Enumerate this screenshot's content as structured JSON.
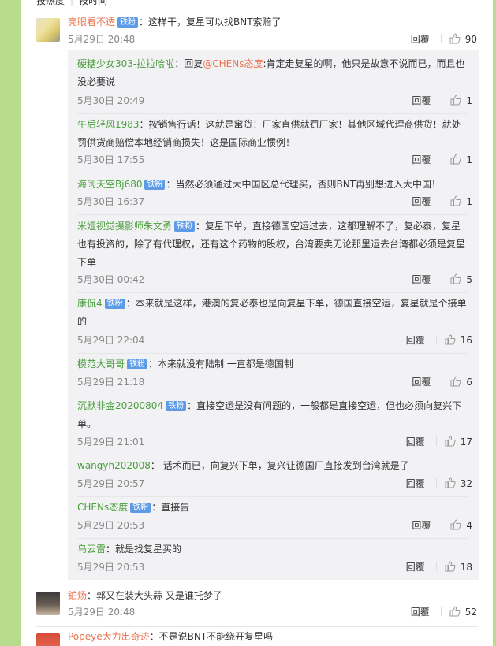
{
  "sort": {
    "hot": "按热度",
    "time": "按时间"
  },
  "comments": [
    {
      "user": "亮眼看不透",
      "badge": "铁粉",
      "text": "：这样干，复星可以找BNT索赔了",
      "time": "5月29日 20:48",
      "reply_label": "回覆",
      "likes": "90",
      "replies": [
        {
          "user": "硬糖少女303-拉拉哈啦",
          "badge": "",
          "text_pre": "：回复",
          "mention": "@CHENs态度",
          "text": ":肯定走复星的啊，他只是故意不说而已，而且也没必要说",
          "time": "5月30日 20:49",
          "reply_label": "回覆",
          "likes": "1"
        },
        {
          "user": "午后轻风1983",
          "badge": "",
          "text": "：按销售行话！这就是窜货！厂家直供就罚厂家！其他区域代理商供货！就处罚供货商赔偿本地经销商损失！这是国际商业惯例！",
          "time": "5月30日 17:55",
          "reply_label": "回覆",
          "likes": "1"
        },
        {
          "user": "海阔天空Bj680",
          "badge": "铁粉",
          "text": "：当然必须通过大中国区总代理买，否则BNT再别想进入大中国！",
          "time": "5月30日 16:37",
          "reply_label": "回覆",
          "likes": "1"
        },
        {
          "user": "米娅视觉摄影师朱文勇",
          "badge": "铁粉",
          "text": "：复星下单，直接德国空运过去，这都理解不了，复必泰，复星也有投资的，除了有代理权，还有这个药物的股权，台湾要卖无论那里运去台湾都必须是复星下单",
          "time": "5月30日 00:42",
          "reply_label": "回覆",
          "likes": "5"
        },
        {
          "user": "康侃4",
          "badge": "铁粉",
          "text": "：本来就是这样，港澳的复必泰也是向复星下单，德国直接空运，复星就是个接单的",
          "time": "5月29日 22:04",
          "reply_label": "回覆",
          "likes": "16"
        },
        {
          "user": "模范大哥哥",
          "badge": "铁粉",
          "text": "：本来就没有陆制 一直都是德国制",
          "time": "5月29日 21:18",
          "reply_label": "回覆",
          "likes": "6"
        },
        {
          "user": "沉默非金20200804",
          "badge": "铁粉",
          "text": "：直接空运是没有问题的，一般都是直接空运，但也必须向复兴下单。",
          "time": "5月29日 21:01",
          "reply_label": "回覆",
          "likes": "17"
        },
        {
          "user": "wangyh202008",
          "badge": "",
          "text": "： 话术而已，向复兴下单，复兴让德国厂直接发到台湾就是了",
          "time": "5月29日 20:57",
          "reply_label": "回覆",
          "likes": "32"
        },
        {
          "user": "CHENs态度",
          "badge": "铁粉",
          "text": "：直接告",
          "time": "5月29日 20:53",
          "reply_label": "回覆",
          "likes": "4"
        },
        {
          "user": "乌云雷",
          "badge": "",
          "text": "：就是找复星买的",
          "time": "5月29日 20:53",
          "reply_label": "回覆",
          "likes": "18"
        }
      ]
    },
    {
      "user": "鉑炀",
      "badge": "",
      "text": "：郭又在装大头蒜  又是谁托梦了",
      "time": "5月29日 20:48",
      "reply_label": "回覆",
      "likes": "52"
    },
    {
      "user": "Popeye大力出奇迹",
      "badge": "",
      "text": "：不是说BNT不能绕开复星吗"
    }
  ],
  "colors": {
    "username": "#eb7350",
    "badge": "#5d9be6",
    "side": "#b7dc8c",
    "reply_bg": "#f2f2f5"
  }
}
